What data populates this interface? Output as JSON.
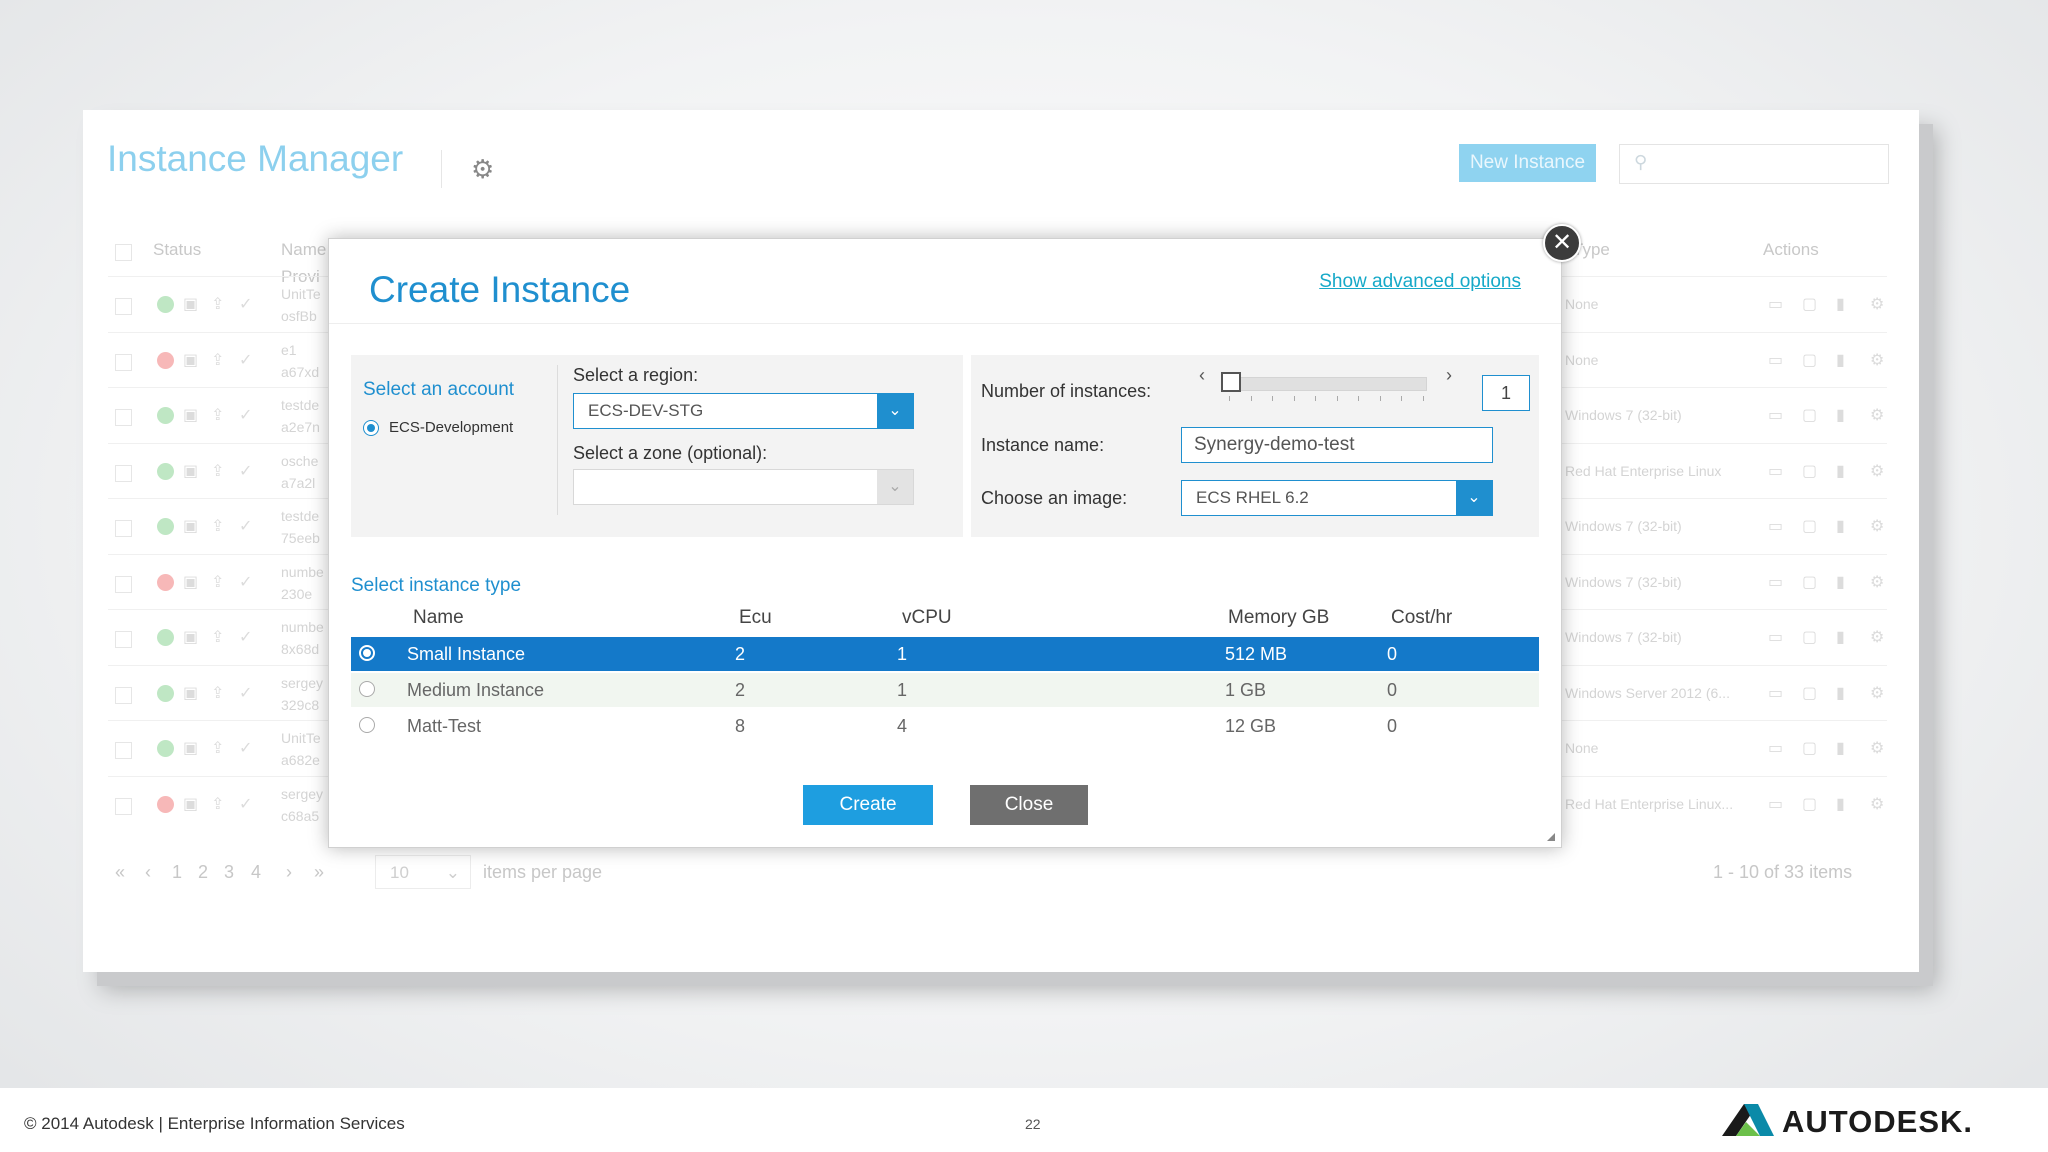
{
  "app": {
    "title": "Instance Manager",
    "new_instance_label": "New Instance",
    "columns": {
      "status": "Status",
      "name": "Name",
      "provider": "Provi",
      "type": "Type",
      "actions": "Actions"
    },
    "rows": [
      {
        "status": "green",
        "name": "UnitTe",
        "sub": "osfBb",
        "type": "None"
      },
      {
        "status": "red",
        "name": "e1",
        "sub": "a67xd",
        "type": "None"
      },
      {
        "status": "green",
        "name": "testde",
        "sub": "a2e7n",
        "type": "Windows 7 (32-bit)"
      },
      {
        "status": "green",
        "name": "osche",
        "sub": "a7a2l",
        "type": "Red Hat Enterprise Linux"
      },
      {
        "status": "green",
        "name": "testde",
        "sub": "75eeb",
        "type": "Windows 7 (32-bit)"
      },
      {
        "status": "red",
        "name": "numbe",
        "sub": "230e",
        "type": "Windows 7 (32-bit)"
      },
      {
        "status": "green",
        "name": "numbe",
        "sub": "8x68d",
        "type": "Windows 7 (32-bit)"
      },
      {
        "status": "green",
        "name": "sergey",
        "sub": "329c8",
        "type": "Windows Server 2012 (6..."
      },
      {
        "status": "green",
        "name": "UnitTe",
        "sub": "a682e",
        "type": "None"
      },
      {
        "status": "red",
        "name": "sergey",
        "sub": "c68a5",
        "type": "Red Hat Enterprise Linux..."
      }
    ],
    "pager": {
      "first": "«",
      "prev": "‹",
      "pages": [
        "1",
        "2",
        "3",
        "4"
      ],
      "next": "›",
      "last": "»",
      "per_page": "10",
      "per_page_label": "items per page",
      "range": "1 - 10 of 33 items"
    }
  },
  "modal": {
    "title": "Create Instance",
    "advanced_link": "Show advanced options",
    "account": {
      "label": "Select an account",
      "option": "ECS-Development"
    },
    "region": {
      "label": "Select a region:",
      "value": "ECS-DEV-STG"
    },
    "zone": {
      "label": "Select a zone (optional):",
      "value": ""
    },
    "instances": {
      "label": "Number of instances:",
      "value": "1",
      "left": "‹",
      "right": "›"
    },
    "instance_name": {
      "label": "Instance name:",
      "value": "Synergy-demo-test"
    },
    "image": {
      "label": "Choose an image:",
      "value": "ECS RHEL 6.2"
    },
    "instance_type": {
      "label": "Select instance type",
      "headers": {
        "name": "Name",
        "ecu": "Ecu",
        "vcpu": "vCPU",
        "memory": "Memory GB",
        "cost": "Cost/hr"
      },
      "rows": [
        {
          "name": "Small Instance",
          "ecu": "2",
          "vcpu": "1",
          "memory": "512 MB",
          "cost": "0",
          "selected": true
        },
        {
          "name": "Medium Instance",
          "ecu": "2",
          "vcpu": "1",
          "memory": "1 GB",
          "cost": "0",
          "selected": false
        },
        {
          "name": "Matt-Test",
          "ecu": "8",
          "vcpu": "4",
          "memory": "12 GB",
          "cost": "0",
          "selected": false
        }
      ]
    },
    "create_label": "Create",
    "close_label": "Close"
  },
  "footer": {
    "copyright": "© 2014 Autodesk | Enterprise Information Services",
    "page": "22",
    "logo_text": "AUTODESK."
  },
  "colors": {
    "accent": "#1f8fcf",
    "selected_row": "#1479c9",
    "create": "#1e9ee0",
    "close": "#6f6f6f"
  },
  "icons": [
    "gear-icon",
    "search-icon",
    "close-icon",
    "chevron-down-icon",
    "autodesk-logo"
  ]
}
